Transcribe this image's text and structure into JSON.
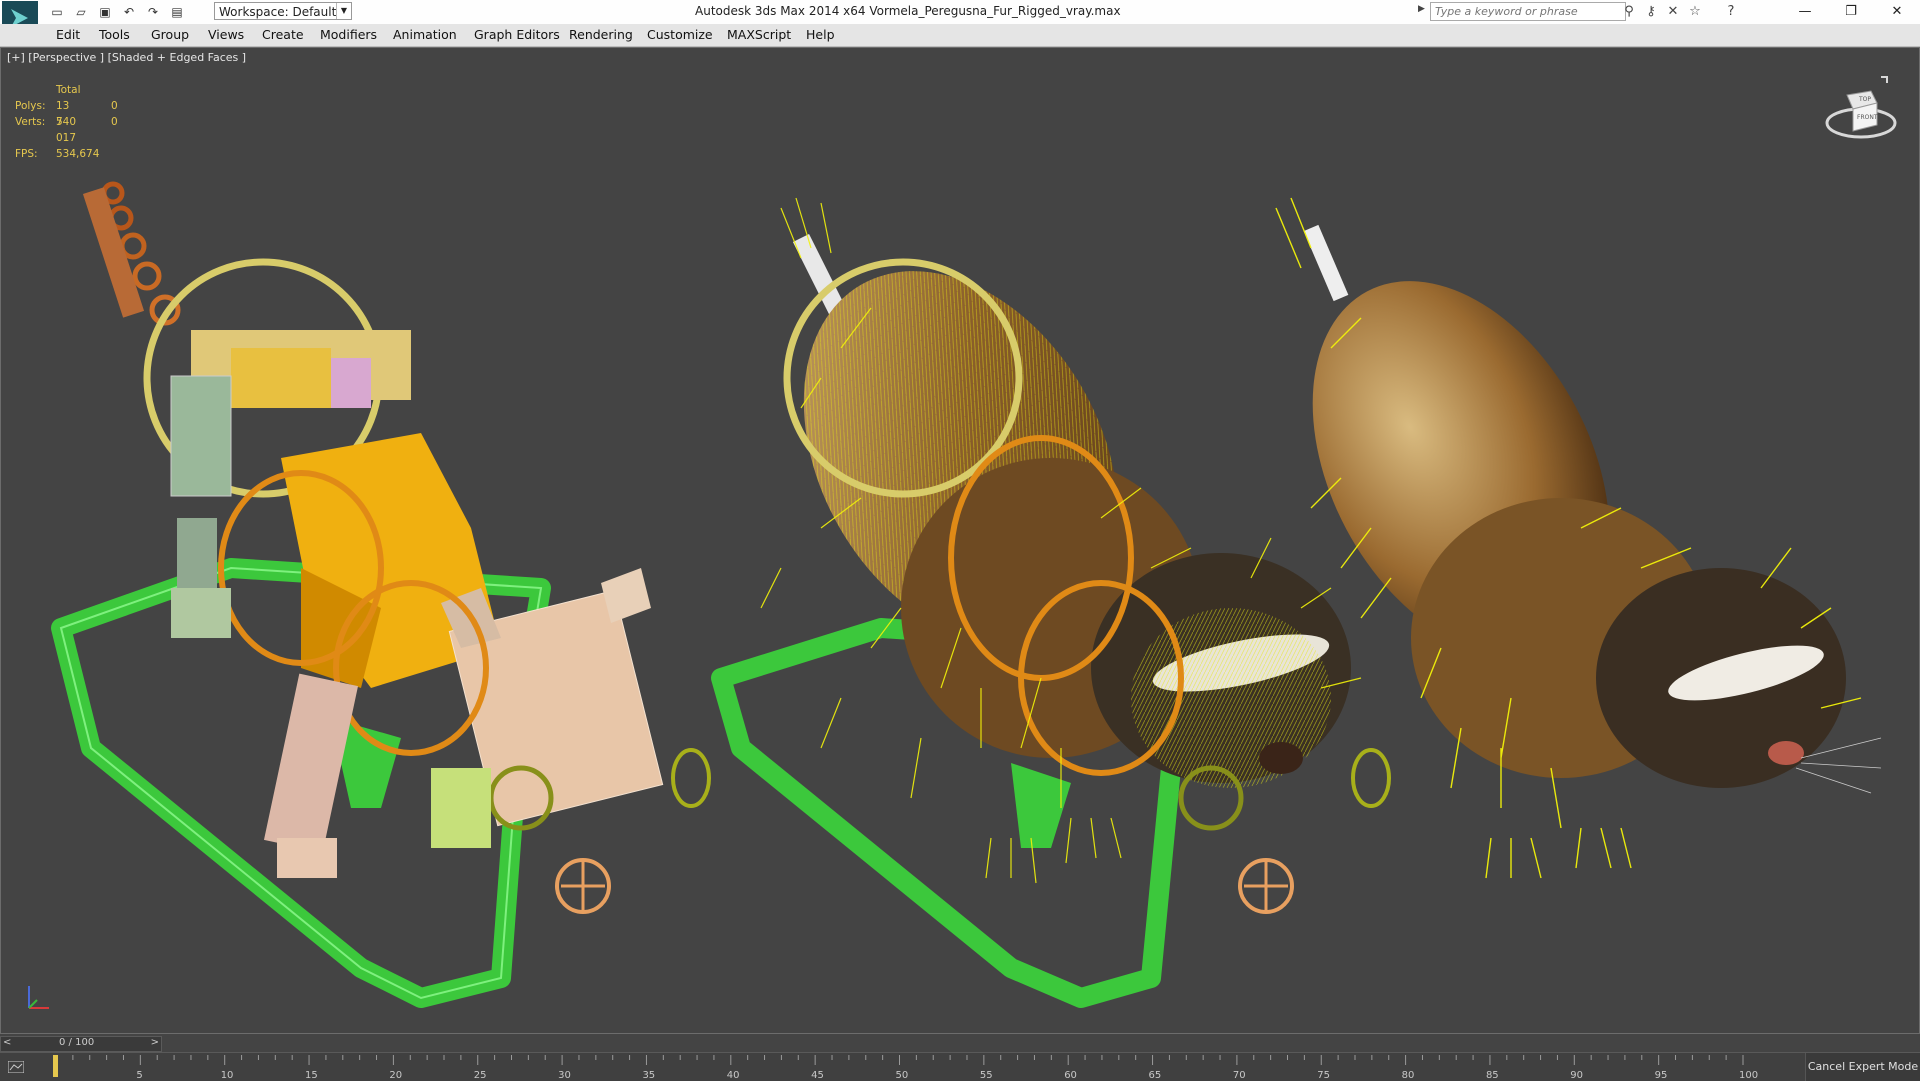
{
  "titlebar": {
    "workspace_label": "Workspace: Default",
    "app_title": "Autodesk 3ds Max  2014 x64     Vormela_Peregusna_Fur_Rigged_vray.max",
    "search_placeholder": "Type a keyword or phrase"
  },
  "menu": {
    "items": [
      {
        "label": "Edit"
      },
      {
        "label": "Tools"
      },
      {
        "label": "Group"
      },
      {
        "label": "Views"
      },
      {
        "label": "Create"
      },
      {
        "label": "Modifiers"
      },
      {
        "label": "Animation"
      },
      {
        "label": "Graph Editors"
      },
      {
        "label": "Rendering"
      },
      {
        "label": "Customize"
      },
      {
        "label": "MAXScript"
      },
      {
        "label": "Help"
      }
    ]
  },
  "viewport": {
    "label": "[+] [Perspective ] [Shaded + Edged Faces ]",
    "stats": {
      "header": "Total",
      "polys_label": "Polys:",
      "polys_value": "13 540",
      "polys_sel": "0",
      "verts_label": "Verts:",
      "verts_value": "7 017",
      "verts_sel": "0",
      "fps_label": "FPS:",
      "fps_value": "534,674"
    },
    "viewcube": {
      "top": "TOP",
      "front": "FRONT"
    }
  },
  "timeline": {
    "frame_label": "0 / 100",
    "prev": "<",
    "next": ">",
    "ticks": [
      "5",
      "10",
      "15",
      "20",
      "25",
      "30",
      "35",
      "40",
      "45",
      "50",
      "55",
      "60",
      "65",
      "70",
      "75",
      "80",
      "85",
      "90",
      "95",
      "100"
    ],
    "cancel_label": "Cancel Expert Mode"
  },
  "colors": {
    "accent_yellow": "#e6c84e",
    "fur_yellow": "#f2f20a",
    "control_green": "#4cc94c",
    "ring_orange": "#e08a16",
    "ring_yellow": "#d6c865"
  }
}
